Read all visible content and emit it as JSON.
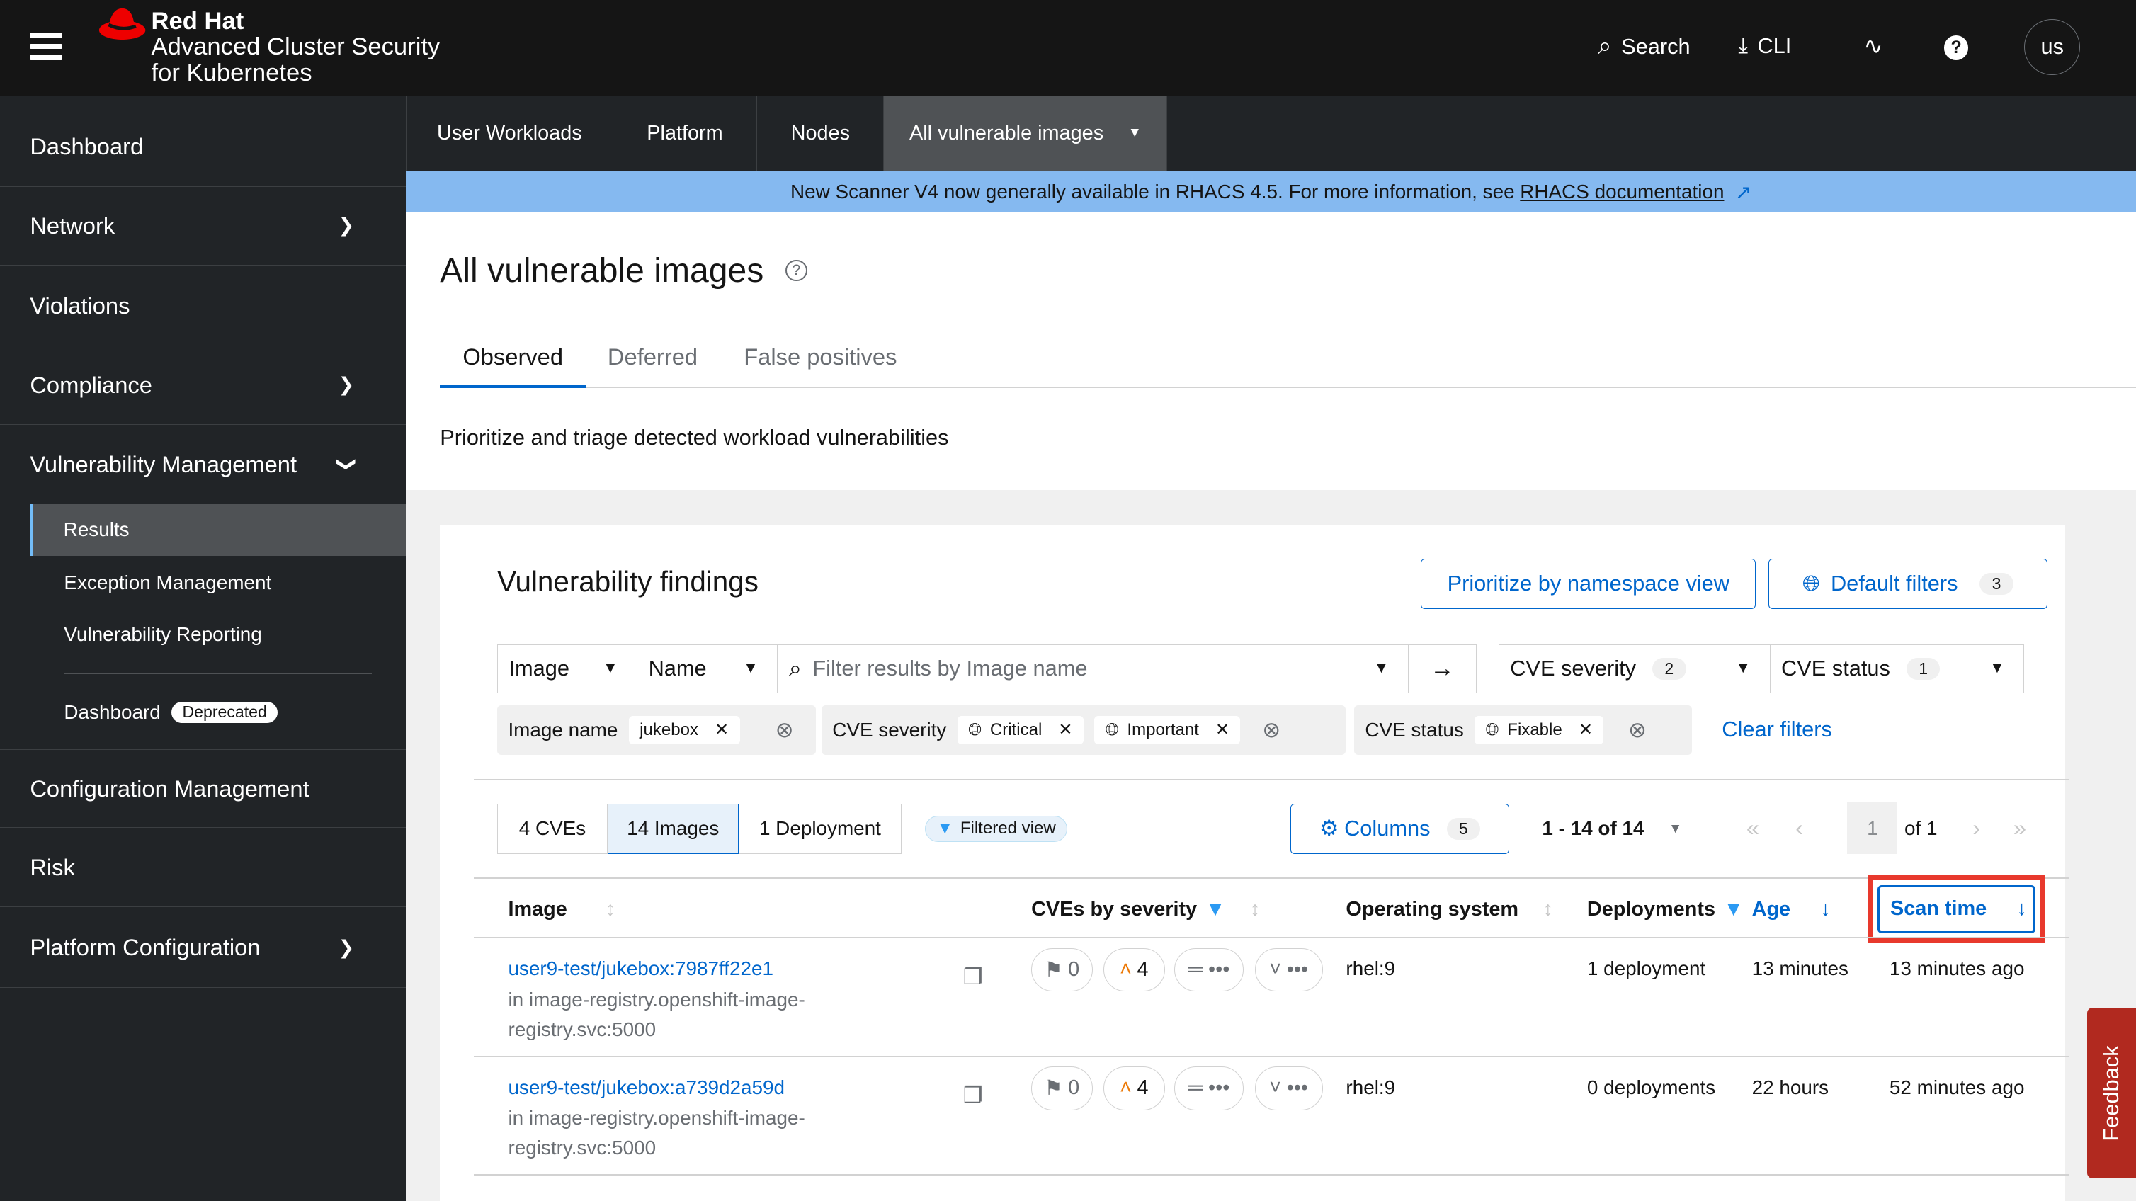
{
  "header": {
    "brand": "Red Hat",
    "product_line1": "Advanced Cluster Security",
    "product_line2": "for Kubernetes",
    "search": "Search",
    "cli": "CLI",
    "user": "us"
  },
  "sidebar": {
    "items": [
      {
        "label": "Dashboard"
      },
      {
        "label": "Network"
      },
      {
        "label": "Violations"
      },
      {
        "label": "Compliance"
      },
      {
        "label": "Vulnerability Management"
      },
      {
        "label": "Configuration Management"
      },
      {
        "label": "Risk"
      },
      {
        "label": "Platform Configuration"
      }
    ],
    "vm_sub": [
      {
        "label": "Results",
        "active": true
      },
      {
        "label": "Exception Management"
      },
      {
        "label": "Vulnerability Reporting"
      },
      {
        "label": "Dashboard",
        "badge": "Deprecated"
      }
    ]
  },
  "top_tabs": [
    {
      "label": "User Workloads"
    },
    {
      "label": "Platform"
    },
    {
      "label": "Nodes"
    },
    {
      "label": "All vulnerable images",
      "active": true
    }
  ],
  "banner": {
    "text": "New Scanner V4 now generally available in RHACS 4.5. For more information, see",
    "link": "RHACS documentation"
  },
  "page": {
    "title": "All vulnerable images",
    "tabs": [
      {
        "label": "Observed",
        "active": true
      },
      {
        "label": "Deferred"
      },
      {
        "label": "False positives"
      }
    ],
    "description": "Prioritize and triage detected workload vulnerabilities"
  },
  "findings": {
    "title": "Vulnerability findings",
    "prioritize_btn": "Prioritize by namespace view",
    "default_filters": "Default filters",
    "default_filters_count": "3",
    "filter": {
      "entity": "Image",
      "attribute": "Name",
      "placeholder": "Filter results by Image name",
      "cve_severity": "CVE severity",
      "cve_severity_count": "2",
      "cve_status": "CVE status",
      "cve_status_count": "1"
    },
    "chips": {
      "image_name_label": "Image name",
      "image_name_value": "jukebox",
      "severity_label": "CVE severity",
      "severity_values": [
        "Critical",
        "Important"
      ],
      "status_label": "CVE status",
      "status_values": [
        "Fixable"
      ],
      "clear": "Clear filters"
    },
    "toggle": [
      "4 CVEs",
      "14 Images",
      "1 Deployment"
    ],
    "toggle_selected": "14 Images",
    "filtered_view": "Filtered view",
    "columns": "Columns",
    "columns_count": "5",
    "pagination": {
      "range": "1 - 14 of 14",
      "page": "1",
      "of": "of 1"
    },
    "table": {
      "headers": [
        "Image",
        "CVEs by severity",
        "Operating system",
        "Deployments",
        "Age",
        "Scan time"
      ],
      "rows": [
        {
          "image": "user9-test/jukebox:7987ff22e1",
          "registry": "in image-registry.openshift-image-registry.svc:5000",
          "critical": "0",
          "important": "4",
          "moderate": "•••",
          "low": "•••",
          "os": "rhel:9",
          "deployments": "1 deployment",
          "age": "13 minutes",
          "scan_time": "13 minutes ago"
        },
        {
          "image": "user9-test/jukebox:a739d2a59d",
          "registry": "in image-registry.openshift-image-registry.svc:5000",
          "critical": "0",
          "important": "4",
          "moderate": "•••",
          "low": "•••",
          "os": "rhel:9",
          "deployments": "0 deployments",
          "age": "22 hours",
          "scan_time": "52 minutes ago"
        }
      ]
    }
  },
  "feedback": "Feedback",
  "colors": {
    "link": "#0066cc",
    "important": "#ec7a08",
    "highlight": "#e8392d",
    "banner": "#85b9f0"
  }
}
